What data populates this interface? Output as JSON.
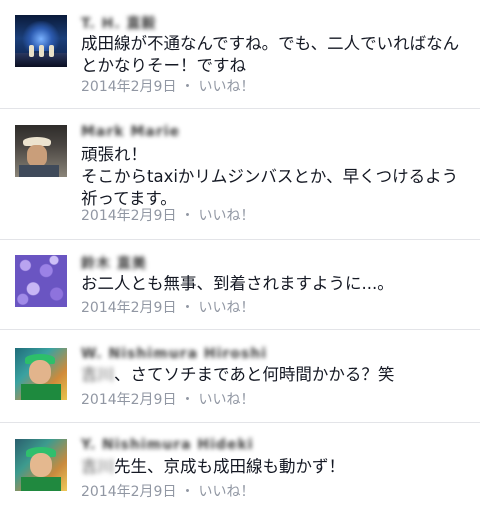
{
  "comments": [
    {
      "name": "T. H. 直毅",
      "text": "成田線が不通なんですね。でも、二人でいればなんとかなりそー！ですね",
      "date": "2014年2月9日",
      "like": "いいね！",
      "avatar_icon": "stage-performance-photo"
    },
    {
      "name": "Mark Marie",
      "text_lines": [
        "頑張れ！",
        "そこからtaxiかリムジンバスとか、早くつけるよう祈ってます。"
      ],
      "date": "2014年2月9日",
      "like": "いいね！",
      "avatar_icon": "man-with-hat-photo"
    },
    {
      "name": "鈴木 直美",
      "text": "お二人とも無事、到着されますように...。",
      "date": "2014年2月9日",
      "like": "いいね！",
      "avatar_icon": "purple-flowers-photo"
    },
    {
      "name": "W. Nishimura Hiroshi",
      "text_prefix": "吉川",
      "text": "、さてソチまであと何時間かかる？笑",
      "date": "2014年2月9日",
      "like": "いいね！",
      "avatar_icon": "person-green-hat-photo"
    },
    {
      "name": "Y. Nishimura Hideki",
      "text_prefix": "吉川",
      "text": "先生、京成も成田線も動かず！",
      "date": "2014年2月9日",
      "like": "いいね！",
      "avatar_icon": "person-green-hat-photo"
    }
  ],
  "separator": "・",
  "colors": {
    "text": "#141823",
    "meta": "#9197a3",
    "divider": "#e3e4e8"
  }
}
